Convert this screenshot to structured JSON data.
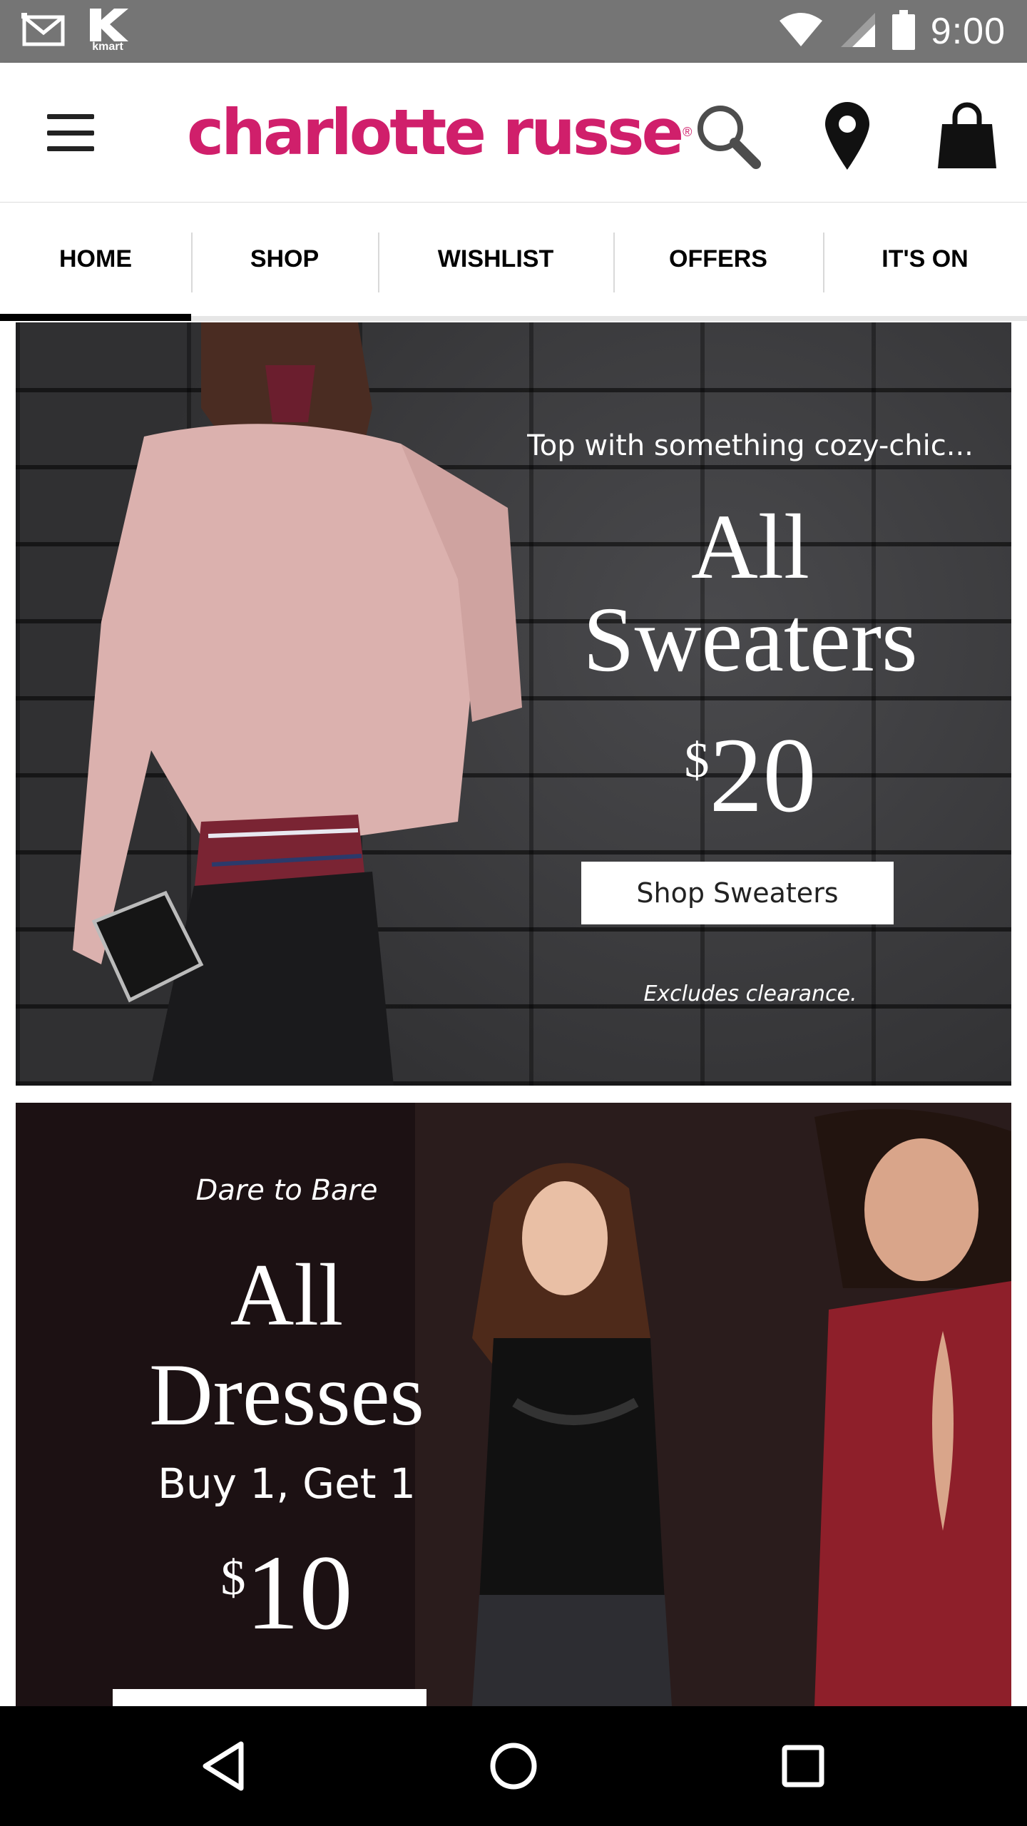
{
  "status_bar": {
    "time": "9:00",
    "left_icons": [
      "gmail-icon",
      "kmart-icon"
    ],
    "kmart_label": "kmart",
    "right_icons": [
      "wifi-icon",
      "signal-icon",
      "battery-icon"
    ]
  },
  "header": {
    "brand": "charlotte russe",
    "brand_mark": "®",
    "brand_color": "#d01f6b",
    "icons": [
      "menu-icon",
      "search-icon",
      "location-pin-icon",
      "shopping-bag-icon"
    ]
  },
  "tabs": [
    {
      "label": "HOME",
      "active": true
    },
    {
      "label": "SHOP",
      "active": false
    },
    {
      "label": "WISHLIST",
      "active": false
    },
    {
      "label": "OFFERS",
      "active": false
    },
    {
      "label": "IT'S ON",
      "active": false
    }
  ],
  "banners": {
    "sweaters": {
      "kicker": "Top with something cozy-chic...",
      "headline_line1": "All",
      "headline_line2": "Sweaters",
      "price_symbol": "$",
      "price": "20",
      "cta": "Shop Sweaters",
      "note": "Excludes clearance."
    },
    "dresses": {
      "kicker": "Dare to Bare",
      "headline_line1": "All",
      "headline_line2": "Dresses",
      "offer": "Buy 1, Get 1",
      "price_symbol": "$",
      "price": "10"
    }
  },
  "nav_bar": {
    "icons": [
      "back-icon",
      "home-icon",
      "recents-icon"
    ]
  }
}
